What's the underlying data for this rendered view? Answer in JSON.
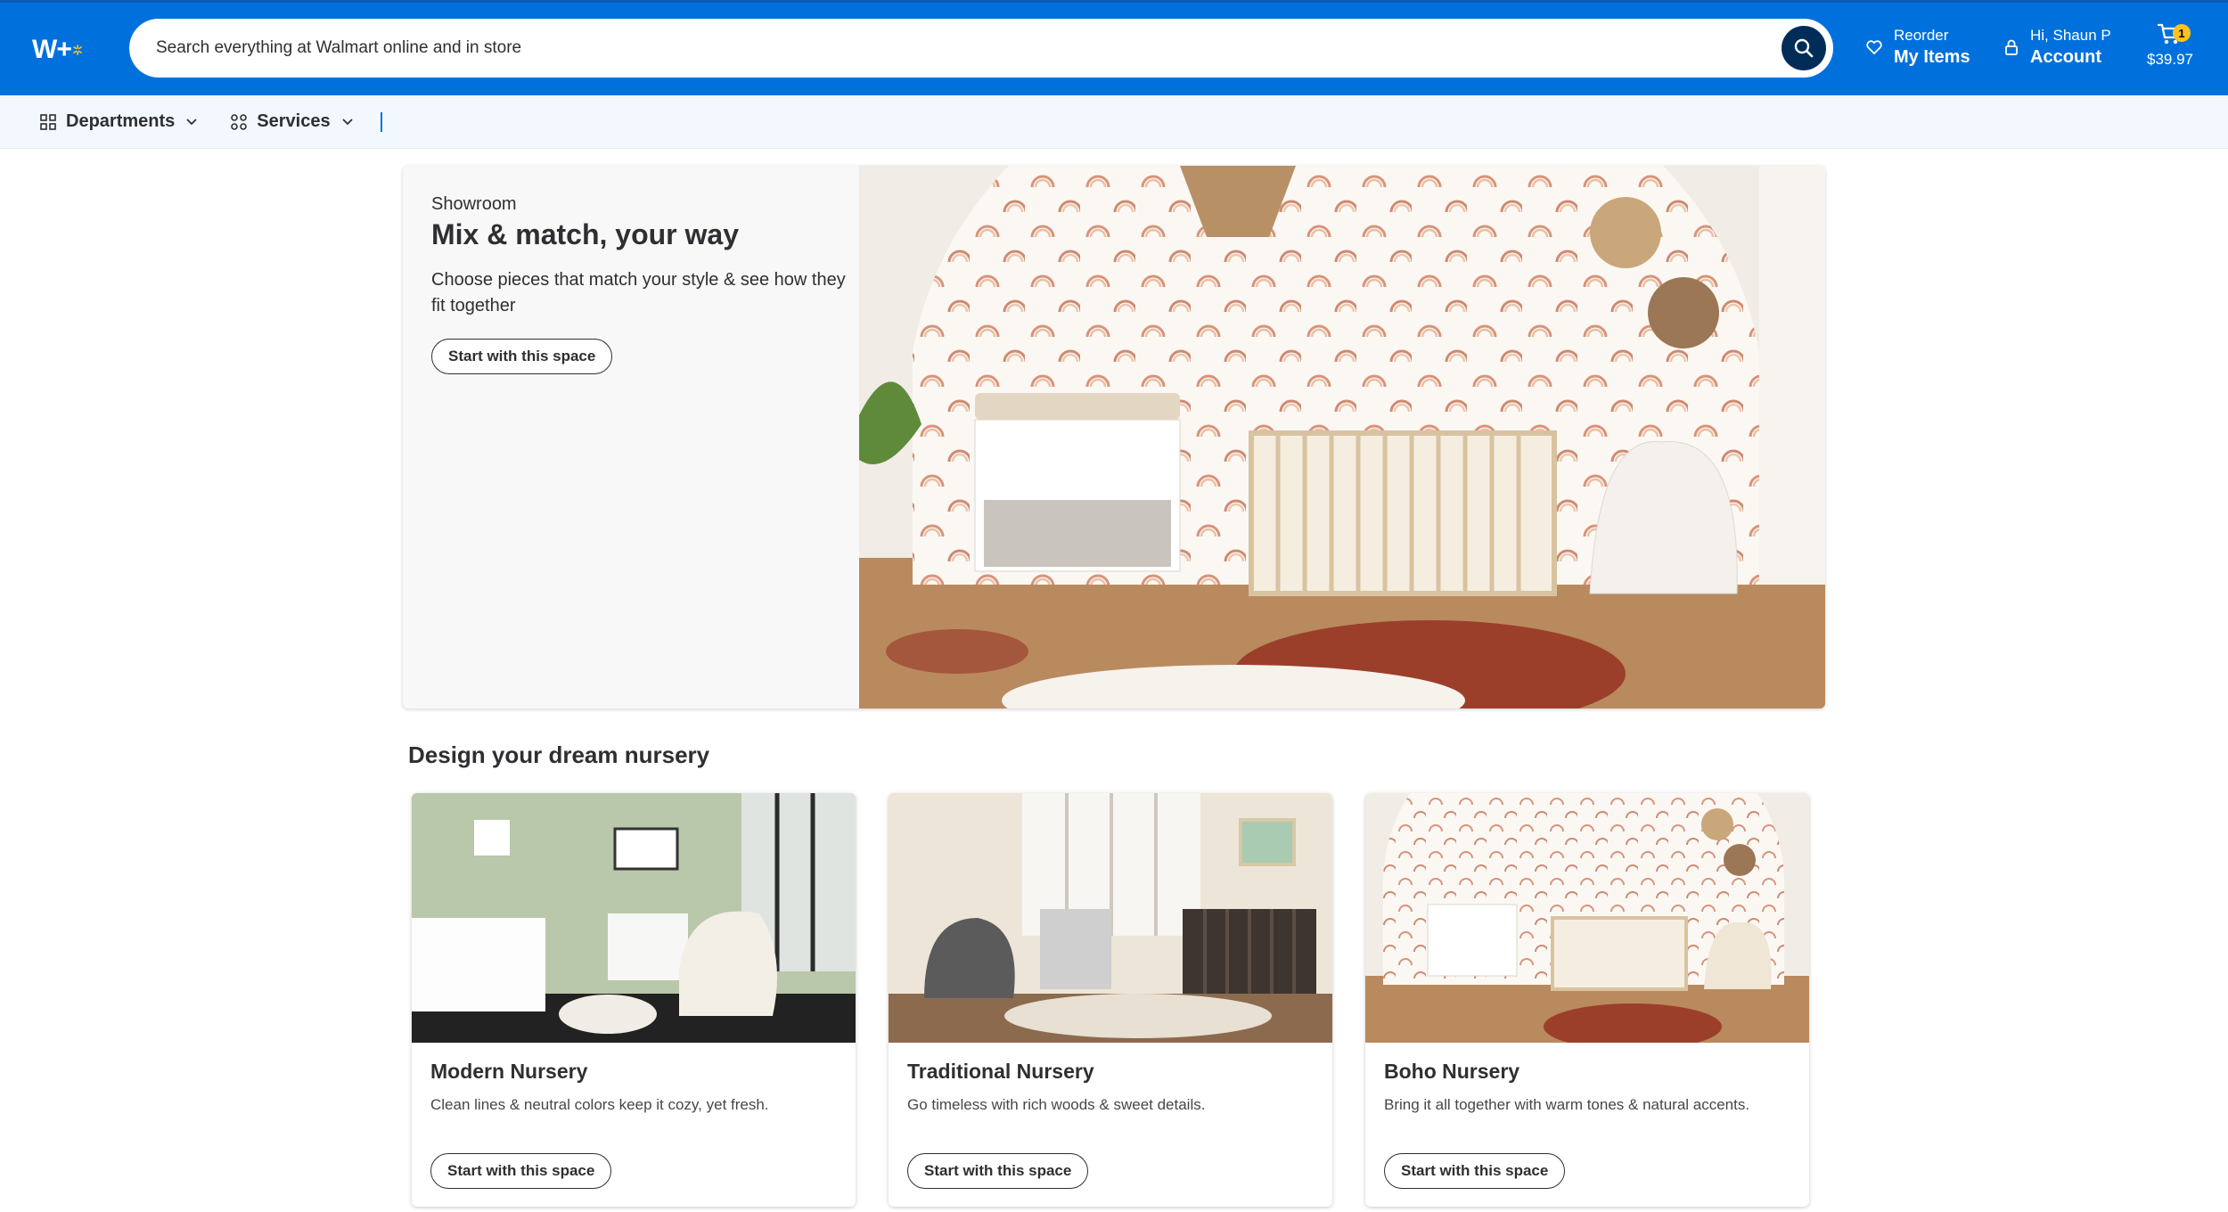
{
  "header": {
    "search_placeholder": "Search everything at Walmart online and in store",
    "reorder_small": "Reorder",
    "reorder_big": "My Items",
    "account_small": "Hi, Shaun P",
    "account_big": "Account",
    "cart_count": "1",
    "cart_total": "$39.97",
    "brand_color": "#0071dc",
    "spark_color": "#ffc220"
  },
  "subnav": {
    "departments": "Departments",
    "services": "Services"
  },
  "hero": {
    "eyebrow": "Showroom",
    "title": "Mix & match, your way",
    "description": "Choose pieces that match your style & see how they fit together",
    "button": "Start with this space"
  },
  "section": {
    "title": "Design your dream nursery"
  },
  "cards": [
    {
      "title": "Modern Nursery",
      "description": "Clean lines & neutral colors keep it cozy, yet fresh.",
      "button": "Start with this space"
    },
    {
      "title": "Traditional Nursery",
      "description": "Go timeless with rich woods & sweet details.",
      "button": "Start with this space"
    },
    {
      "title": "Boho Nursery",
      "description": "Bring it all together with warm tones & natural accents.",
      "button": "Start with this space"
    }
  ]
}
